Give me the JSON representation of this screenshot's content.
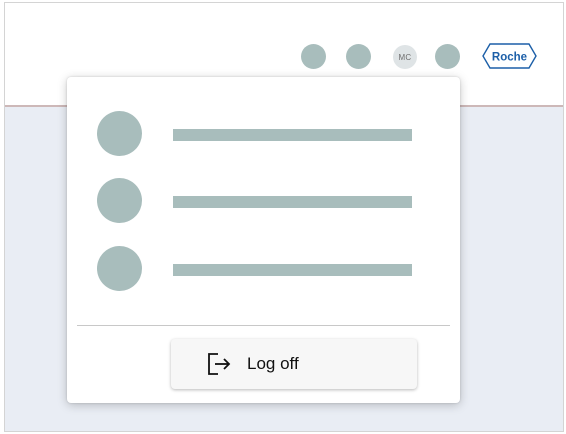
{
  "header": {
    "user_initials": "MC",
    "logo_text": "Roche",
    "icons": [
      "app-icon-1",
      "app-icon-2",
      "app-icon-3"
    ]
  },
  "user_menu": {
    "items": [
      {
        "icon": "menu-item-icon"
      },
      {
        "icon": "menu-item-icon"
      },
      {
        "icon": "menu-item-icon"
      }
    ],
    "logoff": {
      "label": "Log off",
      "icon": "logout-icon"
    }
  },
  "colors": {
    "placeholder": "#a8bdbc",
    "content_background": "#e9edf4",
    "brand": "#1c5fa8"
  }
}
